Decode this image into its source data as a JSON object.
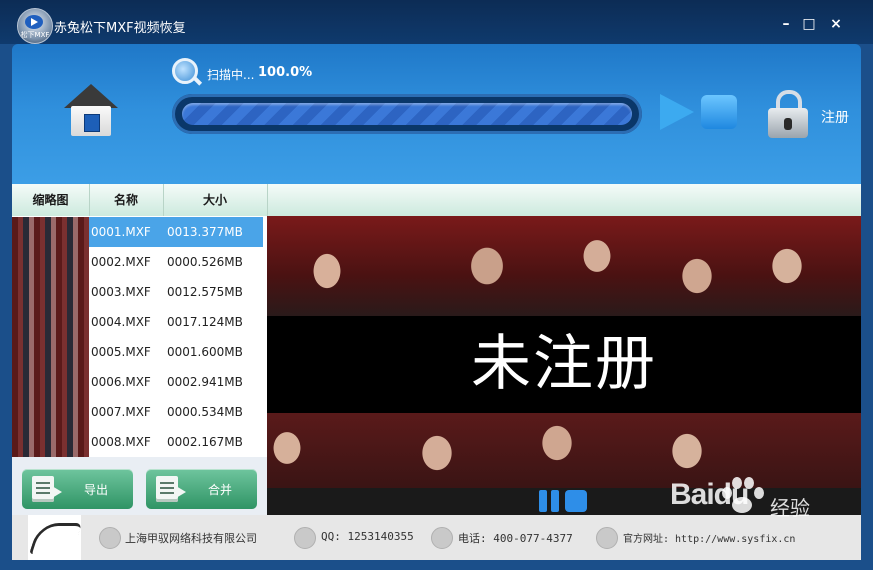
{
  "window": {
    "title": "赤兔松下MXF视频恢复",
    "app_icon_text": "松下MXF",
    "controls": {
      "minimize": "–",
      "maximize": "□",
      "close": "×"
    }
  },
  "scan": {
    "status_label": "扫描中...",
    "percent_text": "100.0%",
    "progress": 1.0
  },
  "header": {
    "register_label": "注册"
  },
  "list": {
    "columns": [
      "缩略图",
      "名称",
      "大小"
    ],
    "rows": [
      {
        "name": "0001.MXF",
        "size": "0013.377MB"
      },
      {
        "name": "0002.MXF",
        "size": "0000.526MB"
      },
      {
        "name": "0003.MXF",
        "size": "0012.575MB"
      },
      {
        "name": "0004.MXF",
        "size": "0017.124MB"
      },
      {
        "name": "0005.MXF",
        "size": "0001.600MB"
      },
      {
        "name": "0006.MXF",
        "size": "0002.941MB"
      },
      {
        "name": "0007.MXF",
        "size": "0000.534MB"
      },
      {
        "name": "0008.MXF",
        "size": "0002.167MB"
      }
    ],
    "selected_index": 0
  },
  "actions": {
    "export_label": "导出",
    "merge_label": "合并"
  },
  "preview": {
    "overlay_text": "未注册"
  },
  "footer": {
    "company": "上海甲驭网络科技有限公司",
    "qq": "QQ: 1253140355",
    "phone": "电话: 400-077-4377",
    "website": "官方网址: http://www.sysfix.cn"
  },
  "watermark": {
    "brand": "Baidu",
    "suffix": "经验"
  },
  "colors": {
    "header_blue": "#2f8fdc",
    "selection_blue": "#4aa4e8",
    "button_green": "#3fa574",
    "titlebar_navy": "#0f3a6d"
  }
}
